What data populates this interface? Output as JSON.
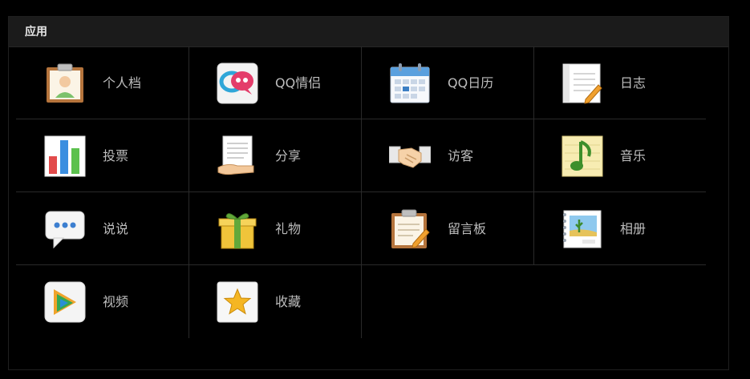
{
  "panel": {
    "title": "应用"
  },
  "apps": [
    {
      "label": "个人档",
      "icon": "profile-clipboard-icon"
    },
    {
      "label": "QQ情侣",
      "icon": "qq-lovers-icon"
    },
    {
      "label": "QQ日历",
      "icon": "calendar-icon"
    },
    {
      "label": "日志",
      "icon": "diary-notebook-icon"
    },
    {
      "label": "投票",
      "icon": "bar-chart-vote-icon"
    },
    {
      "label": "分享",
      "icon": "share-document-icon"
    },
    {
      "label": "访客",
      "icon": "handshake-visitor-icon"
    },
    {
      "label": "音乐",
      "icon": "music-note-icon"
    },
    {
      "label": "说说",
      "icon": "speech-bubble-icon"
    },
    {
      "label": "礼物",
      "icon": "gift-box-icon"
    },
    {
      "label": "留言板",
      "icon": "message-board-clipboard-icon"
    },
    {
      "label": "相册",
      "icon": "photo-album-icon"
    },
    {
      "label": "视频",
      "icon": "video-play-icon"
    },
    {
      "label": "收藏",
      "icon": "favorite-star-icon"
    }
  ],
  "colors": {
    "background": "#000000",
    "header": "#1b1b1b",
    "label": "#bdbdbd",
    "divider": "#2a2a2a"
  }
}
